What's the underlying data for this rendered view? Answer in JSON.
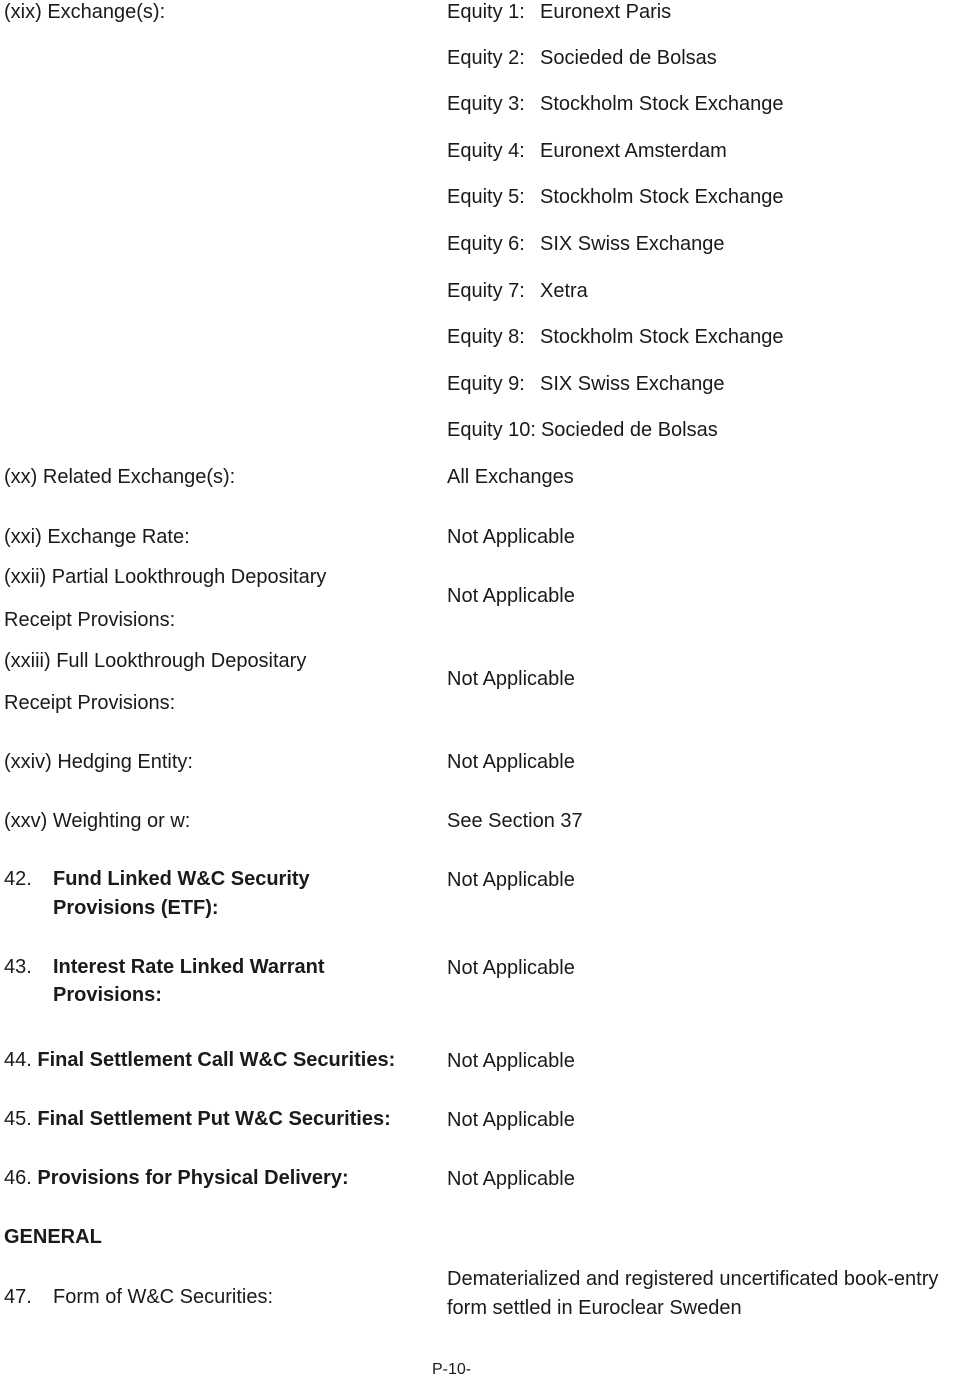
{
  "document": {
    "sections": {
      "xix": {
        "label": "(xix) Exchange(s):",
        "equities": [
          {
            "label": "Equity 1:",
            "exchange": "Euronext Paris"
          },
          {
            "label": "Equity 2:",
            "exchange": "Socieded de Bolsas"
          },
          {
            "label": "Equity 3:",
            "exchange": "Stockholm Stock Exchange"
          },
          {
            "label": "Equity 4:",
            "exchange": "Euronext Amsterdam"
          },
          {
            "label": "Equity 5:",
            "exchange": "Stockholm Stock Exchange"
          },
          {
            "label": "Equity 6:",
            "exchange": "SIX Swiss Exchange"
          },
          {
            "label": "Equity 7:",
            "exchange": "Xetra"
          },
          {
            "label": "Equity 8:",
            "exchange": "Stockholm Stock Exchange"
          },
          {
            "label": "Equity 9:",
            "exchange": "SIX Swiss Exchange"
          },
          {
            "label": "Equity 10:",
            "exchange": "Socieded de Bolsas"
          }
        ]
      },
      "xx": {
        "label": "(xx) Related Exchange(s):",
        "value": "All Exchanges"
      },
      "xxi": {
        "label": "(xxi) Exchange Rate:",
        "value": "Not Applicable"
      },
      "xxii": {
        "label_line1": "(xxii) Partial Lookthrough Depositary",
        "label_line2": "Receipt Provisions:",
        "value": "Not Applicable"
      },
      "xxiii": {
        "label_line1": "(xxiii) Full Lookthrough Depositary",
        "label_line2": "Receipt Provisions:",
        "value": "Not Applicable"
      },
      "xxiv": {
        "label": "(xxiv) Hedging Entity:",
        "value": "Not Applicable"
      },
      "xxv": {
        "label": "(xxv) Weighting or w:",
        "value": "See Section 37"
      }
    },
    "items": {
      "i42": {
        "number": "42.",
        "title_line1": "Fund Linked W&C Security",
        "title_line2": "Provisions (ETF):",
        "value": "Not Applicable"
      },
      "i43": {
        "number": "43.",
        "title_line1": "Interest Rate Linked Warrant",
        "title_line2": "Provisions:",
        "value": "Not Applicable"
      },
      "i44": {
        "number": "44.",
        "title": "Final Settlement Call W&C Securities:",
        "value": "Not Applicable"
      },
      "i45": {
        "number": "45.",
        "title": "Final Settlement Put W&C Securities:",
        "value": "Not Applicable"
      },
      "i46": {
        "number": "46.",
        "title": "Provisions for Physical Delivery:",
        "value": "Not Applicable"
      }
    },
    "general": {
      "heading": "GENERAL",
      "i47": {
        "number": "47.",
        "title": "Form of W&C Securities:",
        "value_line1": "Dematerialized and registered uncertificated book-entry",
        "value_line2": "form settled in Euroclear Sweden"
      }
    },
    "footer": {
      "page_number": "P-10-"
    }
  }
}
